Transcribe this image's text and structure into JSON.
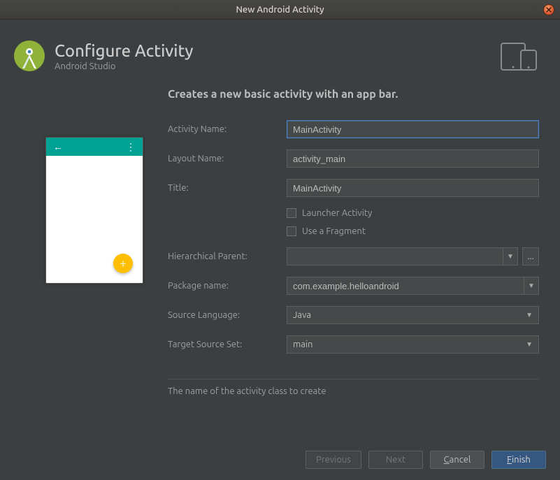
{
  "titlebar": {
    "title": "New Android Activity"
  },
  "header": {
    "title": "Configure Activity",
    "subtitle": "Android Studio"
  },
  "description": "Creates a new basic activity with an app bar.",
  "form": {
    "activity_name_label": "Activity Name:",
    "activity_name_value": "MainActivity",
    "layout_name_label": "Layout Name:",
    "layout_name_value": "activity_main",
    "title_label": "Title:",
    "title_value": "MainActivity",
    "launcher_label": "Launcher Activity",
    "fragment_label": "Use a Fragment",
    "hier_parent_label": "Hierarchical Parent:",
    "hier_parent_value": "",
    "browse_label": "...",
    "package_label": "Package name:",
    "package_value": "com.example.helloandroid",
    "source_lang_label": "Source Language:",
    "source_lang_value": "Java",
    "target_set_label": "Target Source Set:",
    "target_set_value": "main"
  },
  "help_text": "The name of the activity class to create",
  "buttons": {
    "previous": "Previous",
    "next": "Next",
    "cancel_pre": "",
    "cancel_mn": "C",
    "cancel_post": "ancel",
    "finish_pre": "",
    "finish_mn": "F",
    "finish_post": "inish"
  }
}
